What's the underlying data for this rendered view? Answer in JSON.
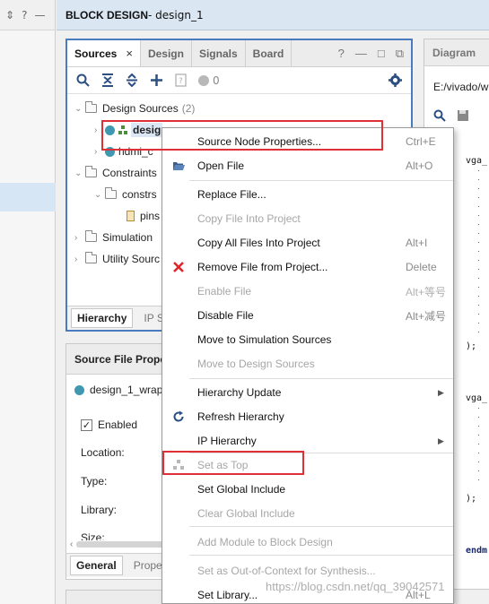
{
  "header": {
    "title_prefix": "BLOCK DESIGN",
    "title_rest": " - design_1"
  },
  "left_strip": {
    "icons": [
      "⇕",
      "?",
      "—"
    ]
  },
  "sources": {
    "tabs": [
      {
        "label": "Sources",
        "active": true
      },
      {
        "label": "Design"
      },
      {
        "label": "Signals"
      },
      {
        "label": "Board"
      }
    ],
    "tab_close": "×",
    "tab_tools": [
      "?",
      "—",
      "□",
      "⧉"
    ],
    "toolbar": {
      "count": "0"
    },
    "tree": {
      "design_sources": "Design Sources",
      "design_sources_count": "(2)",
      "design_wrapper": "desig",
      "hdmi": "hdmi_c",
      "constraints": "Constraints",
      "constrs": "constrs",
      "pins": "pins",
      "simulation": "Simulation",
      "utility": "Utility Sourc"
    },
    "bottom_tabs": [
      "Hierarchy",
      "IP S"
    ]
  },
  "properties": {
    "title": "Source File Prope",
    "file": "design_1_wrap",
    "enabled_label": "Enabled",
    "location_label": "Location:",
    "type_label": "Type:",
    "library_label": "Library:",
    "size_label": "Size:",
    "tabs": [
      "General",
      "Prope"
    ]
  },
  "diagram": {
    "title": "Diagram",
    "path": "E:/vivado/w",
    "code_lines": [
      "vga_",
      ");",
      "vga_",
      ");",
      "endm"
    ]
  },
  "context_menu": {
    "items": [
      {
        "label": "Source Node Properties...",
        "shortcut": "Ctrl+E",
        "icon": ""
      },
      {
        "label": "Open File",
        "shortcut": "Alt+O",
        "icon": "open-folder"
      },
      {
        "label": "Replace File...",
        "shortcut": ""
      },
      {
        "label": "Copy File Into Project",
        "shortcut": "",
        "disabled": true
      },
      {
        "label": "Copy All Files Into Project",
        "shortcut": "Alt+I"
      },
      {
        "label": "Remove File from Project...",
        "shortcut": "Delete",
        "icon": "remove"
      },
      {
        "label": "Enable File",
        "shortcut": "Alt+等号",
        "disabled": true
      },
      {
        "label": "Disable File",
        "shortcut": "Alt+减号"
      },
      {
        "label": "Move to Simulation Sources",
        "shortcut": ""
      },
      {
        "label": "Move to Design Sources",
        "shortcut": "",
        "disabled": true
      },
      {
        "label": "Hierarchy Update",
        "shortcut": "",
        "submenu": true
      },
      {
        "label": "Refresh Hierarchy",
        "shortcut": "",
        "icon": "refresh"
      },
      {
        "label": "IP Hierarchy",
        "shortcut": "",
        "submenu": true
      },
      {
        "label": "Set as Top",
        "shortcut": "",
        "disabled": true,
        "icon": "set-top"
      },
      {
        "label": "Set Global Include",
        "shortcut": ""
      },
      {
        "label": "Clear Global Include",
        "shortcut": "",
        "disabled": true
      },
      {
        "label": "Add Module to Block Design",
        "shortcut": "",
        "disabled": true
      },
      {
        "label": "Set as Out-of-Context for Synthesis...",
        "shortcut": "",
        "disabled": true
      },
      {
        "label": "Set Library...",
        "shortcut": "Alt+L"
      }
    ]
  },
  "watermark": "https://blog.csdn.net/qq_39042571",
  "colors": {
    "highlight": "#e03037",
    "accent": "#4a7bbf",
    "selection": "#dbe7f5"
  }
}
